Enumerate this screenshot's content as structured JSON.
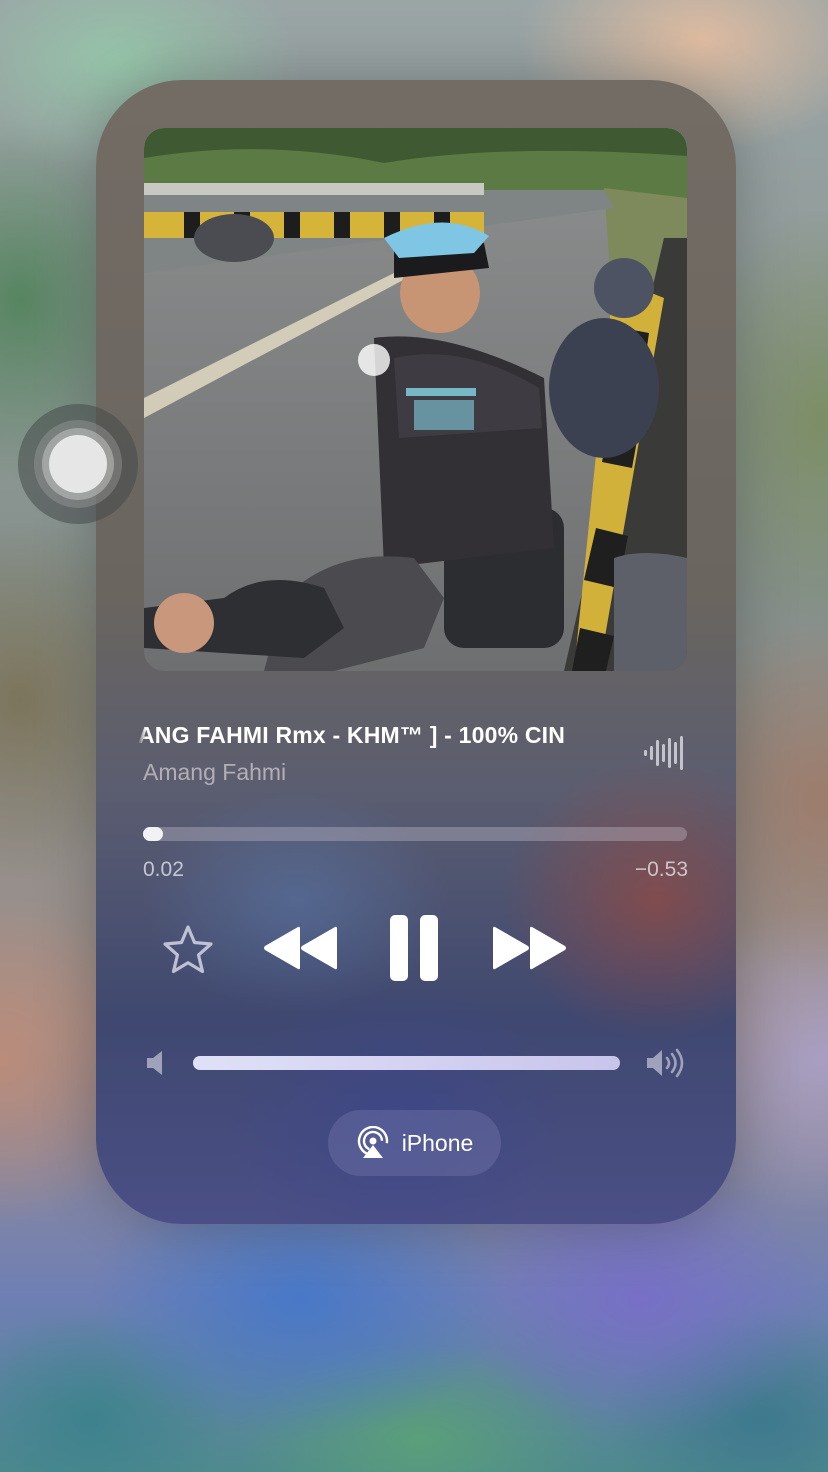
{
  "now_playing": {
    "title": "ANG FAHMI Rmx - KHM™ ] - 100% CIN",
    "artist": "Amang Fahmi",
    "elapsed": "0.02",
    "remaining": "−0.53",
    "progress_fraction": 0.037,
    "volume_fraction": 1.0
  },
  "airplay": {
    "device_label": "iPhone"
  },
  "icons": {
    "favorite": "star-icon",
    "previous": "rewind-icon",
    "play_pause": "pause-icon",
    "next": "fast-forward-icon",
    "volume_low": "speaker-low-icon",
    "volume_high": "speaker-high-icon",
    "airplay": "airplay-icon",
    "waveform": "waveform-icon",
    "assistive_touch": "assistive-touch-icon"
  },
  "colors": {
    "text_primary": "#ffffff",
    "text_secondary": "#b9b3b3"
  }
}
